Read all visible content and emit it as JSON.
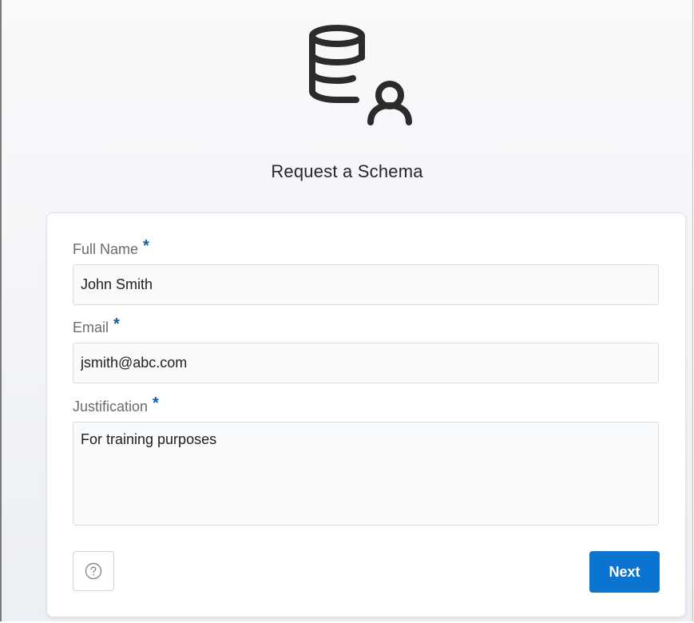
{
  "page": {
    "title": "Request a Schema",
    "logo_icon": "database-user-icon"
  },
  "form": {
    "full_name": {
      "label": "Full Name",
      "required_marker": "*",
      "value": "John Smith"
    },
    "email": {
      "label": "Email",
      "required_marker": "*",
      "value": "jsmith@abc.com"
    },
    "justification": {
      "label": "Justification",
      "required_marker": "*",
      "value": "For training purposes"
    }
  },
  "actions": {
    "help_icon": "question-circle-icon",
    "next_label": "Next"
  },
  "colors": {
    "accent": "#0a74d0",
    "required": "#0b5fa5"
  }
}
